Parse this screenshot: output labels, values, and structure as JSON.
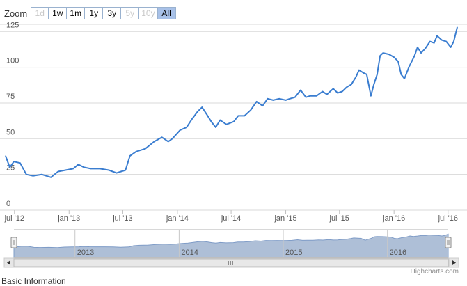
{
  "zoom": {
    "label": "Zoom",
    "buttons": [
      {
        "label": "1d",
        "state": "disabled"
      },
      {
        "label": "1w",
        "state": "normal"
      },
      {
        "label": "1m",
        "state": "normal"
      },
      {
        "label": "1y",
        "state": "normal"
      },
      {
        "label": "3y",
        "state": "normal"
      },
      {
        "label": "5y",
        "state": "disabled"
      },
      {
        "label": "10y",
        "state": "disabled"
      },
      {
        "label": "All",
        "state": "active"
      }
    ]
  },
  "credits": "Highcharts.com",
  "footer_text": "Basic Information",
  "colors": {
    "line": "#3a7dd0",
    "navigator_fill": "#aebfd7",
    "navigator_line": "#7f9cc7",
    "grid": "#d8d8d8",
    "button_active": "#a8c1e8"
  },
  "icons": {
    "scrollbar_left": "arrow-left-icon",
    "scrollbar_right": "arrow-right-icon",
    "scrollbar_grip": "grip-icon",
    "handle": "navigator-handle-icon"
  },
  "chart_data": {
    "type": "line",
    "title": "",
    "xlabel": "",
    "ylabel": "",
    "ylim": [
      0,
      130
    ],
    "yticks": [
      0,
      25,
      50,
      75,
      100,
      125
    ],
    "grid": true,
    "xticks": [
      {
        "label": "jul '12",
        "date": "2012-07-01"
      },
      {
        "label": "jan '13",
        "date": "2013-01-01"
      },
      {
        "label": "jul '13",
        "date": "2013-07-01"
      },
      {
        "label": "jan '14",
        "date": "2014-01-01"
      },
      {
        "label": "jul '14",
        "date": "2014-07-01"
      },
      {
        "label": "jan '15",
        "date": "2015-01-01"
      },
      {
        "label": "jul '15",
        "date": "2015-07-01"
      },
      {
        "label": "jan '16",
        "date": "2016-01-01"
      },
      {
        "label": "jul '16",
        "date": "2016-07-01"
      }
    ],
    "navigator_labels": [
      "2013",
      "2014",
      "2015",
      "2016"
    ],
    "series": [
      {
        "points": [
          [
            "2012-06-01",
            38
          ],
          [
            "2012-06-15",
            30
          ],
          [
            "2012-06-29",
            34
          ],
          [
            "2012-07-20",
            33
          ],
          [
            "2012-08-10",
            25
          ],
          [
            "2012-09-01",
            24
          ],
          [
            "2012-10-01",
            25
          ],
          [
            "2012-11-01",
            23
          ],
          [
            "2012-11-25",
            27
          ],
          [
            "2012-12-20",
            28
          ],
          [
            "2013-01-15",
            29
          ],
          [
            "2013-02-01",
            32
          ],
          [
            "2013-02-20",
            30
          ],
          [
            "2013-03-15",
            29
          ],
          [
            "2013-04-15",
            29
          ],
          [
            "2013-05-15",
            28
          ],
          [
            "2013-06-10",
            26
          ],
          [
            "2013-06-25",
            27
          ],
          [
            "2013-07-10",
            28
          ],
          [
            "2013-07-25",
            38
          ],
          [
            "2013-08-15",
            41
          ],
          [
            "2013-09-15",
            43
          ],
          [
            "2013-10-15",
            48
          ],
          [
            "2013-11-10",
            51
          ],
          [
            "2013-12-01",
            48
          ],
          [
            "2013-12-15",
            50
          ],
          [
            "2014-01-10",
            56
          ],
          [
            "2014-02-01",
            58
          ],
          [
            "2014-02-20",
            64
          ],
          [
            "2014-03-10",
            69
          ],
          [
            "2014-03-25",
            72
          ],
          [
            "2014-04-10",
            67
          ],
          [
            "2014-04-25",
            62
          ],
          [
            "2014-05-10",
            58
          ],
          [
            "2014-05-25",
            63
          ],
          [
            "2014-06-15",
            60
          ],
          [
            "2014-07-10",
            62
          ],
          [
            "2014-07-25",
            66
          ],
          [
            "2014-08-15",
            66
          ],
          [
            "2014-09-05",
            70
          ],
          [
            "2014-09-25",
            76
          ],
          [
            "2014-10-15",
            73
          ],
          [
            "2014-11-01",
            78
          ],
          [
            "2014-11-20",
            77
          ],
          [
            "2014-12-10",
            78
          ],
          [
            "2015-01-01",
            77
          ],
          [
            "2015-01-15",
            78
          ],
          [
            "2015-02-01",
            79
          ],
          [
            "2015-02-20",
            84
          ],
          [
            "2015-03-10",
            79
          ],
          [
            "2015-03-25",
            80
          ],
          [
            "2015-04-15",
            80
          ],
          [
            "2015-05-05",
            83
          ],
          [
            "2015-05-20",
            81
          ],
          [
            "2015-06-10",
            85
          ],
          [
            "2015-06-25",
            82
          ],
          [
            "2015-07-10",
            83
          ],
          [
            "2015-07-25",
            86
          ],
          [
            "2015-08-10",
            88
          ],
          [
            "2015-08-25",
            93
          ],
          [
            "2015-09-05",
            98
          ],
          [
            "2015-09-20",
            96
          ],
          [
            "2015-10-01",
            95
          ],
          [
            "2015-10-15",
            80
          ],
          [
            "2015-10-25",
            88
          ],
          [
            "2015-11-05",
            95
          ],
          [
            "2015-11-15",
            108
          ],
          [
            "2015-11-25",
            110
          ],
          [
            "2015-12-15",
            109
          ],
          [
            "2016-01-01",
            107
          ],
          [
            "2016-01-15",
            104
          ],
          [
            "2016-01-25",
            95
          ],
          [
            "2016-02-05",
            92
          ],
          [
            "2016-02-20",
            100
          ],
          [
            "2016-03-10",
            108
          ],
          [
            "2016-03-20",
            114
          ],
          [
            "2016-04-01",
            110
          ],
          [
            "2016-04-15",
            113
          ],
          [
            "2016-05-01",
            118
          ],
          [
            "2016-05-15",
            117
          ],
          [
            "2016-05-25",
            122
          ],
          [
            "2016-06-10",
            119
          ],
          [
            "2016-06-25",
            118
          ],
          [
            "2016-07-10",
            114
          ],
          [
            "2016-07-20",
            118
          ],
          [
            "2016-08-01",
            128
          ]
        ]
      }
    ]
  }
}
